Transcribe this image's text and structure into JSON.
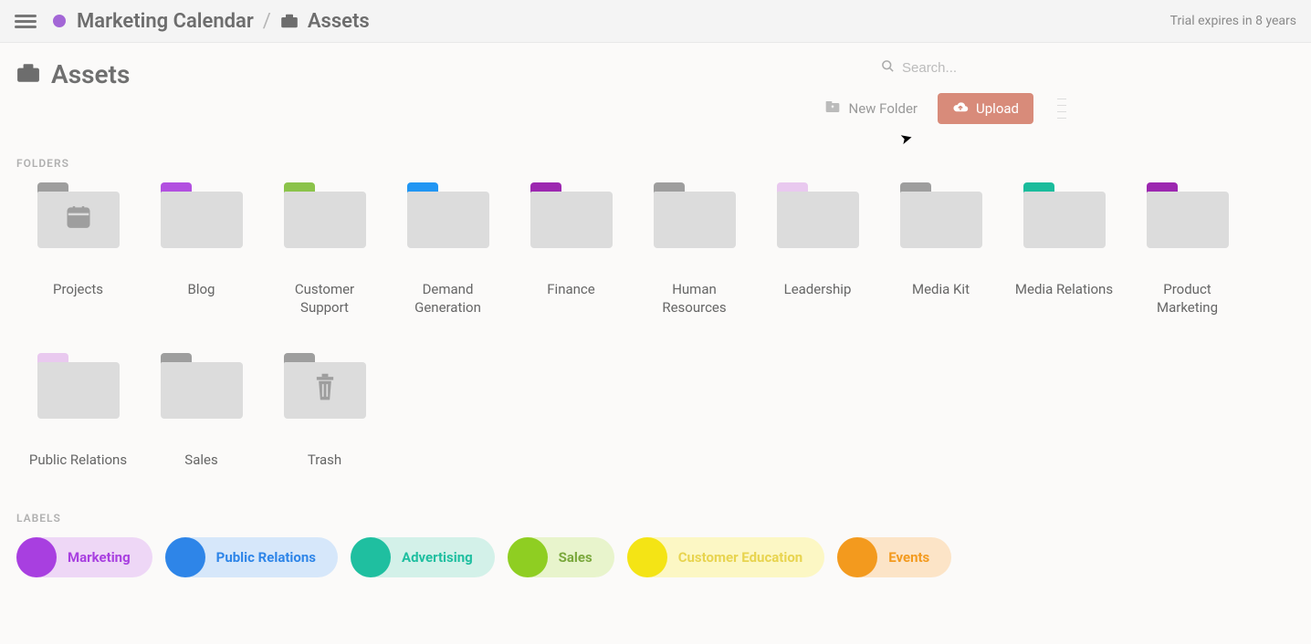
{
  "topbar": {
    "breadcrumb_parent": "Marketing Calendar",
    "breadcrumb_current": "Assets",
    "trial_text": "Trial expires in 8 years"
  },
  "page": {
    "title": "Assets",
    "search_placeholder": "Search...",
    "new_folder_label": "New Folder",
    "upload_label": "Upload"
  },
  "sections": {
    "folders_heading": "FOLDERS",
    "labels_heading": "LABELS"
  },
  "folders": [
    {
      "name": "Projects",
      "tab_color": "#9e9e9e",
      "icon": "calendar"
    },
    {
      "name": "Blog",
      "tab_color": "#b24fe0",
      "icon": null
    },
    {
      "name": "Customer Support",
      "tab_color": "#8bc34a",
      "icon": null
    },
    {
      "name": "Demand Generation",
      "tab_color": "#2196f3",
      "icon": null
    },
    {
      "name": "Finance",
      "tab_color": "#9c27b0",
      "icon": null
    },
    {
      "name": "Human Resources",
      "tab_color": "#9e9e9e",
      "icon": null
    },
    {
      "name": "Leadership",
      "tab_color": "#e9c9ef",
      "icon": null
    },
    {
      "name": "Media Kit",
      "tab_color": "#9e9e9e",
      "icon": null
    },
    {
      "name": "Media Relations",
      "tab_color": "#1abc9c",
      "icon": null
    },
    {
      "name": "Product Marketing",
      "tab_color": "#9c27b0",
      "icon": null
    },
    {
      "name": "Public Relations",
      "tab_color": "#e9c9ef",
      "icon": null
    },
    {
      "name": "Sales",
      "tab_color": "#9e9e9e",
      "icon": null
    },
    {
      "name": "Trash",
      "tab_color": "#9e9e9e",
      "icon": "trash"
    }
  ],
  "labels": [
    {
      "name": "Marketing",
      "dot": "#a83fe0",
      "bg": "#eed7f6",
      "text": "#a83fe0"
    },
    {
      "name": "Public Relations",
      "dot": "#2e85e8",
      "bg": "#d6e7fa",
      "text": "#2e85e8"
    },
    {
      "name": "Advertising",
      "dot": "#1fbfa0",
      "bg": "#d3f1e9",
      "text": "#1fbfa0"
    },
    {
      "name": "Sales",
      "dot": "#8fce22",
      "bg": "#e8f4cc",
      "text": "#7aa83c"
    },
    {
      "name": "Customer Education",
      "dot": "#f4e415",
      "bg": "#fcf7c4",
      "text": "#e8d44f"
    },
    {
      "name": "Events",
      "dot": "#f39a1e",
      "bg": "#fce4c7",
      "text": "#f39a1e"
    }
  ]
}
